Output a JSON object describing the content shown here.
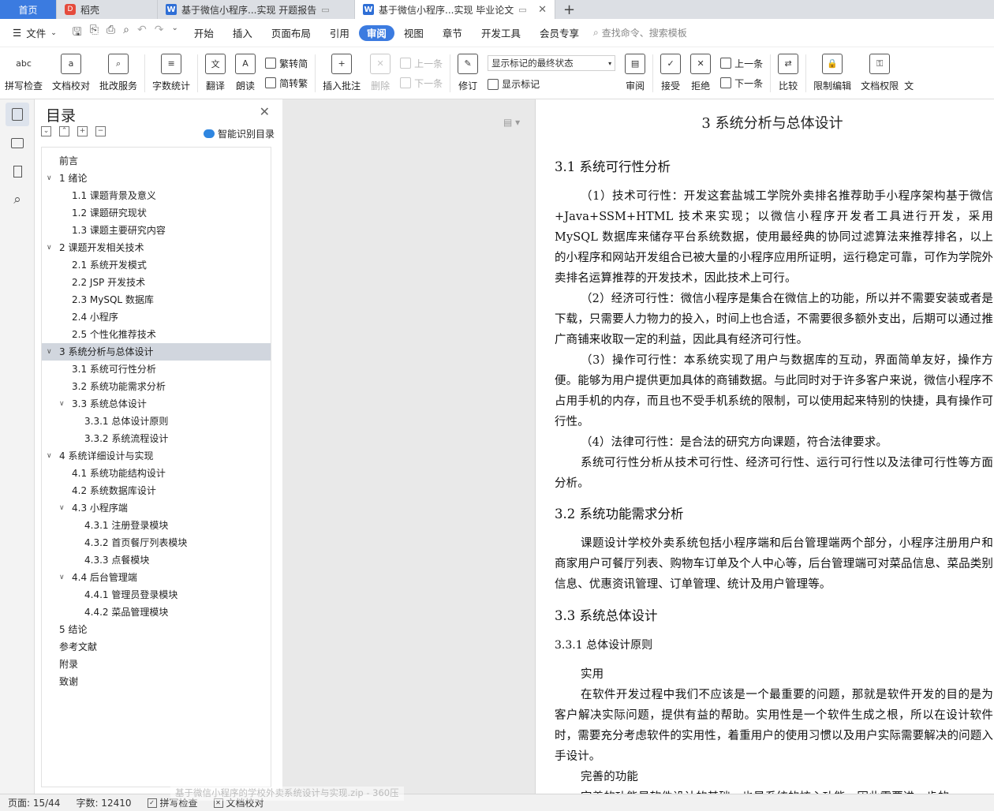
{
  "tabs": [
    {
      "label": "首页",
      "kind": "home"
    },
    {
      "label": "稻壳",
      "kind": "daoke"
    },
    {
      "label": "基于微信小程序...实现 开题报告",
      "kind": "doc"
    },
    {
      "label": "基于微信小程序...实现 毕业论文",
      "kind": "active"
    }
  ],
  "menu": {
    "file": "文件",
    "items": [
      "开始",
      "插入",
      "页面布局",
      "引用",
      "审阅",
      "视图",
      "章节",
      "开发工具",
      "会员专享"
    ],
    "active": "审阅",
    "search": "查找命令、搜索模板"
  },
  "ribbon": {
    "spell": "拼写检查",
    "doccheck": "文档校对",
    "batch": "批改服务",
    "wordcount": "字数统计",
    "translate": "翻译",
    "read": "朗读",
    "trad": "繁转简",
    "simp": "简转繁",
    "insert_comment": "插入批注",
    "delete": "删除",
    "prev": "上一条",
    "next": "下一条",
    "revise": "修订",
    "display_mode": "显示标记的最终状态",
    "show_marks": "显示标记",
    "review": "审阅",
    "accept": "接受",
    "reject": "拒绝",
    "prev2": "上一条",
    "next2": "下一条",
    "compare": "比较",
    "restrict": "限制编辑",
    "permission": "文档权限",
    "extra": "文"
  },
  "toc": {
    "title": "目录",
    "smart": "智能识别目录",
    "items": [
      {
        "text": "前言",
        "level": 1,
        "chev": ""
      },
      {
        "text": "1 绪论",
        "level": 1,
        "chev": "v"
      },
      {
        "text": "1.1 课题背景及意义",
        "level": 2,
        "chev": ""
      },
      {
        "text": "1.2 课题研究现状",
        "level": 2,
        "chev": ""
      },
      {
        "text": "1.3 课题主要研究内容",
        "level": 2,
        "chev": ""
      },
      {
        "text": "2 课题开发相关技术",
        "level": 1,
        "chev": "v"
      },
      {
        "text": "2.1 系统开发模式",
        "level": 2,
        "chev": ""
      },
      {
        "text": "2.2 JSP 开发技术",
        "level": 2,
        "chev": ""
      },
      {
        "text": "2.3 MySQL 数据库",
        "level": 2,
        "chev": ""
      },
      {
        "text": "2.4  小程序",
        "level": 2,
        "chev": ""
      },
      {
        "text": "2.5  个性化推荐技术",
        "level": 2,
        "chev": ""
      },
      {
        "text": "3 系统分析与总体设计",
        "level": 1,
        "chev": "v",
        "selected": true
      },
      {
        "text": "3.1 系统可行性分析",
        "level": 2,
        "chev": ""
      },
      {
        "text": "3.2 系统功能需求分析",
        "level": 2,
        "chev": ""
      },
      {
        "text": "3.3 系统总体设计",
        "level": 2,
        "chev": "v"
      },
      {
        "text": "3.3.1 总体设计原则",
        "level": 3,
        "chev": ""
      },
      {
        "text": "3.3.2 系统流程设计",
        "level": 3,
        "chev": ""
      },
      {
        "text": "4 系统详细设计与实现",
        "level": 1,
        "chev": "v"
      },
      {
        "text": "4.1 系统功能结构设计",
        "level": 2,
        "chev": ""
      },
      {
        "text": "4.2 系统数据库设计",
        "level": 2,
        "chev": ""
      },
      {
        "text": "4.3 小程序端",
        "level": 2,
        "chev": "v"
      },
      {
        "text": "4.3.1 注册登录模块",
        "level": 3,
        "chev": ""
      },
      {
        "text": "4.3.2 首页餐厅列表模块",
        "level": 3,
        "chev": ""
      },
      {
        "text": "4.3.3 点餐模块",
        "level": 3,
        "chev": ""
      },
      {
        "text": "4.4 后台管理端",
        "level": 2,
        "chev": "v"
      },
      {
        "text": "4.4.1 管理员登录模块",
        "level": 3,
        "chev": ""
      },
      {
        "text": "4.4.2 菜品管理模块",
        "level": 3,
        "chev": ""
      },
      {
        "text": "5 结论",
        "level": 1,
        "chev": ""
      },
      {
        "text": "参考文献",
        "level": 1,
        "chev": ""
      },
      {
        "text": "附录",
        "level": 1,
        "chev": ""
      },
      {
        "text": "致谢",
        "level": 1,
        "chev": ""
      }
    ]
  },
  "doc": {
    "h1": "3 系统分析与总体设计",
    "h2_1": "3.1 系统可行性分析",
    "p1": "（1）技术可行性：开发这套盐城工学院外卖排名推荐助手小程序架构基于微信+Java+SSM+HTML 技术来实现；以微信小程序开发者工具进行开发，采用 MySQL 数据库来储存平台系统数据，使用最经典的协同过滤算法来推荐排名，以上的小程序和网站开发组合已被大量的小程序应用所证明，运行稳定可靠，可作为学院外卖排名运算推荐的开发技术，因此技术上可行。",
    "p2": "（2）经济可行性：微信小程序是集合在微信上的功能，所以并不需要安装或者是下载，只需要人力物力的投入，时间上也合适，不需要很多额外支出，后期可以通过推广商铺来收取一定的利益，因此具有经济可行性。",
    "p3": "（3）操作可行性：本系统实现了用户与数据库的互动，界面简单友好，操作方便。能够为用户提供更加具体的商铺数据。与此同时对于许多客户来说，微信小程序不占用手机的内存，而且也不受手机系统的限制，可以使用起来特别的快捷，具有操作可行性。",
    "p4": "（4）法律可行性：是合法的研究方向课题，符合法律要求。",
    "p5": "系统可行性分析从技术可行性、经济可行性、运行可行性以及法律可行性等方面分析。",
    "h2_2": "3.2 系统功能需求分析",
    "p6": "课题设计学校外卖系统包括小程序端和后台管理端两个部分，小程序注册用户和商家用户可餐厅列表、购物车订单及个人中心等，后台管理端可对菜品信息、菜品类别信息、优惠资讯管理、订单管理、统计及用户管理等。",
    "h2_3": "3.3 系统总体设计",
    "h3_1": "3.3.1 总体设计原则",
    "p7": "实用",
    "p8": "在软件开发过程中我们不应该是一个最重要的问题，那就是软件开发的目的是为客户解决实际问题，提供有益的帮助。实用性是一个软件生成之根，所以在设计软件时，需要充分考虑软件的实用性，着重用户的使用习惯以及用户实际需要解决的问题入手设计。",
    "p9": "完善的功能",
    "p10": "完善的功能是软件设计的基础，也是系统的核心功能，因此需要进一步的"
  },
  "status": {
    "page": "页面: 15/44",
    "words": "字数: 12410",
    "spell": "拼写检查",
    "proof": "文档校对",
    "tooltip": "基于微信小程序的学校外卖系统设计与实现.zip - 360压"
  },
  "colors": {
    "accent": "#3b7be0",
    "selected": "#d1d6de"
  }
}
